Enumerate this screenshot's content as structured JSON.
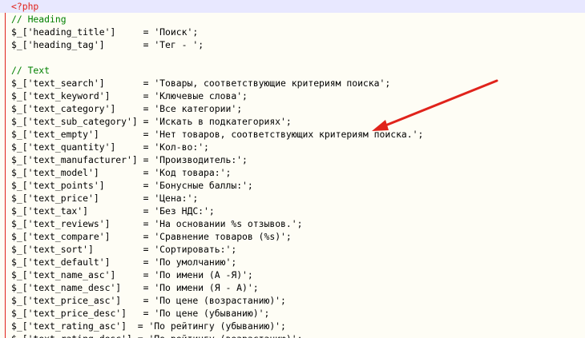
{
  "editor": {
    "open_tag": "<?php",
    "lines": [
      {
        "kind": "comment",
        "text": "// Heading"
      },
      {
        "kind": "code",
        "key": "$_['heading_title']",
        "pad": "     ",
        "op": "= ",
        "value": "'Поиск';"
      },
      {
        "kind": "code",
        "key": "$_['heading_tag']",
        "pad": "       ",
        "op": "= ",
        "value": "'Тег - ';"
      },
      {
        "kind": "blank",
        "text": ""
      },
      {
        "kind": "comment",
        "text": "// Text"
      },
      {
        "kind": "code",
        "key": "$_['text_search']",
        "pad": "       ",
        "op": "= ",
        "value": "'Товары, соответствующие критериям поиска';"
      },
      {
        "kind": "code",
        "key": "$_['text_keyword']",
        "pad": "      ",
        "op": "= ",
        "value": "'Ключевые слова';"
      },
      {
        "kind": "code",
        "key": "$_['text_category']",
        "pad": "     ",
        "op": "= ",
        "value": "'Все категории';"
      },
      {
        "kind": "code",
        "key": "$_['text_sub_category']",
        "pad": " ",
        "op": "= ",
        "value": "'Искать в подкатегориях';"
      },
      {
        "kind": "code",
        "key": "$_['text_empty']",
        "pad": "        ",
        "op": "= ",
        "value": "'Нет товаров, соответствующих критериям поиска.';"
      },
      {
        "kind": "code",
        "key": "$_['text_quantity']",
        "pad": "     ",
        "op": "= ",
        "value": "'Кол-во:';"
      },
      {
        "kind": "code",
        "key": "$_['text_manufacturer']",
        "pad": " ",
        "op": "= ",
        "value": "'Производитель:';"
      },
      {
        "kind": "code",
        "key": "$_['text_model']",
        "pad": "        ",
        "op": "= ",
        "value": "'Код товара:';"
      },
      {
        "kind": "code",
        "key": "$_['text_points']",
        "pad": "       ",
        "op": "= ",
        "value": "'Бонусные баллы:';"
      },
      {
        "kind": "code",
        "key": "$_['text_price']",
        "pad": "        ",
        "op": "= ",
        "value": "'Цена:';"
      },
      {
        "kind": "code",
        "key": "$_['text_tax']",
        "pad": "          ",
        "op": "= ",
        "value": "'Без НДС:';"
      },
      {
        "kind": "code",
        "key": "$_['text_reviews']",
        "pad": "      ",
        "op": "= ",
        "value": "'На основании %s отзывов.';"
      },
      {
        "kind": "code",
        "key": "$_['text_compare']",
        "pad": "      ",
        "op": "= ",
        "value": "'Сравнение товаров (%s)';"
      },
      {
        "kind": "code",
        "key": "$_['text_sort']",
        "pad": "         ",
        "op": "= ",
        "value": "'Сортировать:';"
      },
      {
        "kind": "code",
        "key": "$_['text_default']",
        "pad": "      ",
        "op": "= ",
        "value": "'По умолчанию';"
      },
      {
        "kind": "code",
        "key": "$_['text_name_asc']",
        "pad": "     ",
        "op": "= ",
        "value": "'По имени (А -Я)';"
      },
      {
        "kind": "code",
        "key": "$_['text_name_desc']",
        "pad": "    ",
        "op": "= ",
        "value": "'По имени (Я - А)';"
      },
      {
        "kind": "code",
        "key": "$_['text_price_asc']",
        "pad": "    ",
        "op": "= ",
        "value": "'По цене (возрастанию)';"
      },
      {
        "kind": "code",
        "key": "$_['text_price_desc']",
        "pad": "   ",
        "op": "= ",
        "value": "'По цене (убыванию)';"
      },
      {
        "kind": "code",
        "key": "$_['text_rating_asc']",
        "pad": "  ",
        "op": "= ",
        "value": "'По рейтингу (убыванию)';"
      },
      {
        "kind": "code",
        "key": "$_['text_rating_desc']",
        "pad": " ",
        "op": "= ",
        "value": "'По рейтингу (возрастанию)';"
      }
    ]
  },
  "colors": {
    "background": "#fefdf5",
    "comment": "#008000",
    "php_tag": "#e0231b",
    "annotation_arrow": "#e0231b"
  },
  "icons": {
    "fold": "fold-minus-icon"
  }
}
